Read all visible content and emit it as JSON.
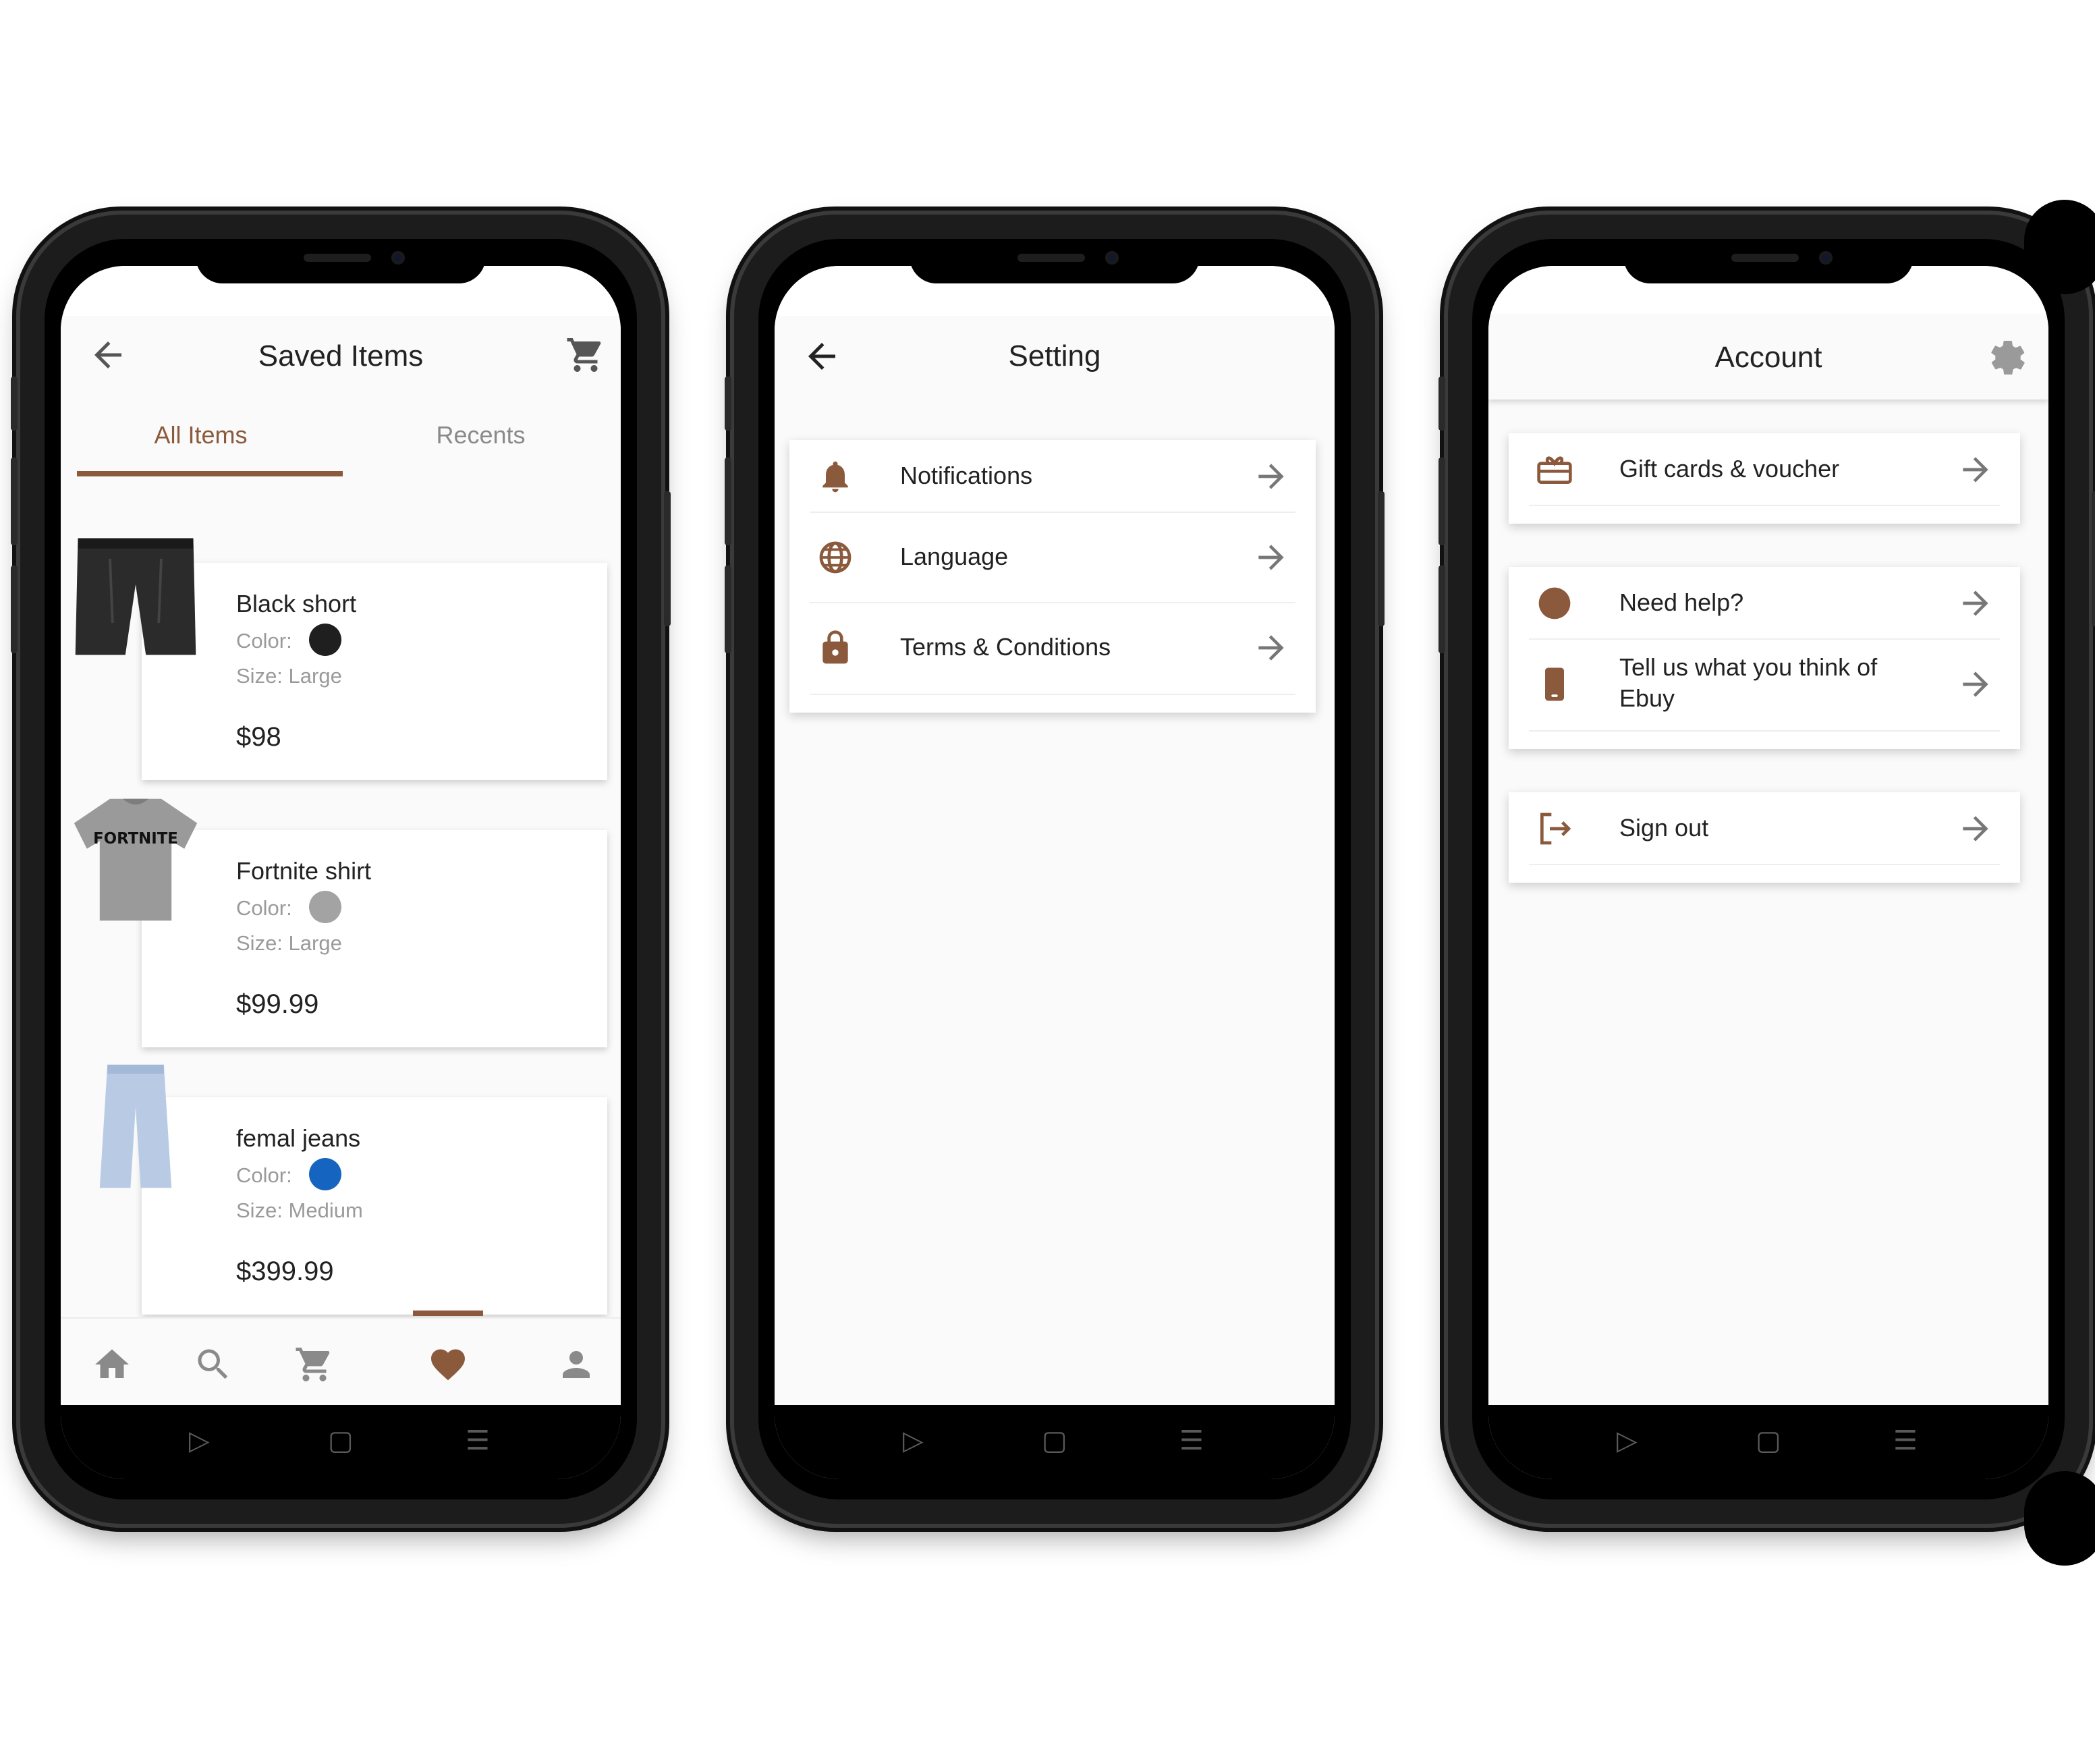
{
  "colors": {
    "accent": "#8b5a3c",
    "swatch_black": "#1f1f1f",
    "swatch_gray": "#a3a3a3",
    "swatch_blue": "#1565c0"
  },
  "saved": {
    "title": "Saved Items",
    "tabs": [
      {
        "label": "All Items"
      },
      {
        "label": "Recents"
      }
    ],
    "color_label": "Color:",
    "items": [
      {
        "name": "Black short",
        "size": "Size:  Large",
        "price": "$98"
      },
      {
        "name": "Fortnite shirt",
        "size": "Size:  Large",
        "price": "$99.99",
        "print": "FORTNITE"
      },
      {
        "name": "femal jeans",
        "size": "Size:  Medium",
        "price": "$399.99"
      }
    ],
    "icons": {
      "back": "arrow-left-icon",
      "cart": "cart-icon",
      "nav": [
        "home-icon",
        "search-icon",
        "cart-icon",
        "heart-icon",
        "person-icon"
      ]
    }
  },
  "setting": {
    "title": "Setting",
    "rows": [
      {
        "label": "Notifications",
        "icon": "bell-icon"
      },
      {
        "label": "Language",
        "icon": "globe-icon"
      },
      {
        "label": "Terms & Conditions",
        "icon": "lock-icon"
      }
    ]
  },
  "account": {
    "title": "Account",
    "rows": [
      {
        "label": "Gift cards & voucher",
        "icon": "gift-card-icon"
      },
      {
        "label": "Need help?",
        "icon": "circle-icon"
      },
      {
        "label": "Tell us what you think of",
        "label2": "Ebuy",
        "icon": "phone-icon"
      },
      {
        "label": "Sign out",
        "icon": "sign-out-icon"
      }
    ],
    "settings_icon": "gear-icon"
  },
  "system_nav": {
    "back": "▷",
    "home": "▢",
    "menu": "☰"
  }
}
